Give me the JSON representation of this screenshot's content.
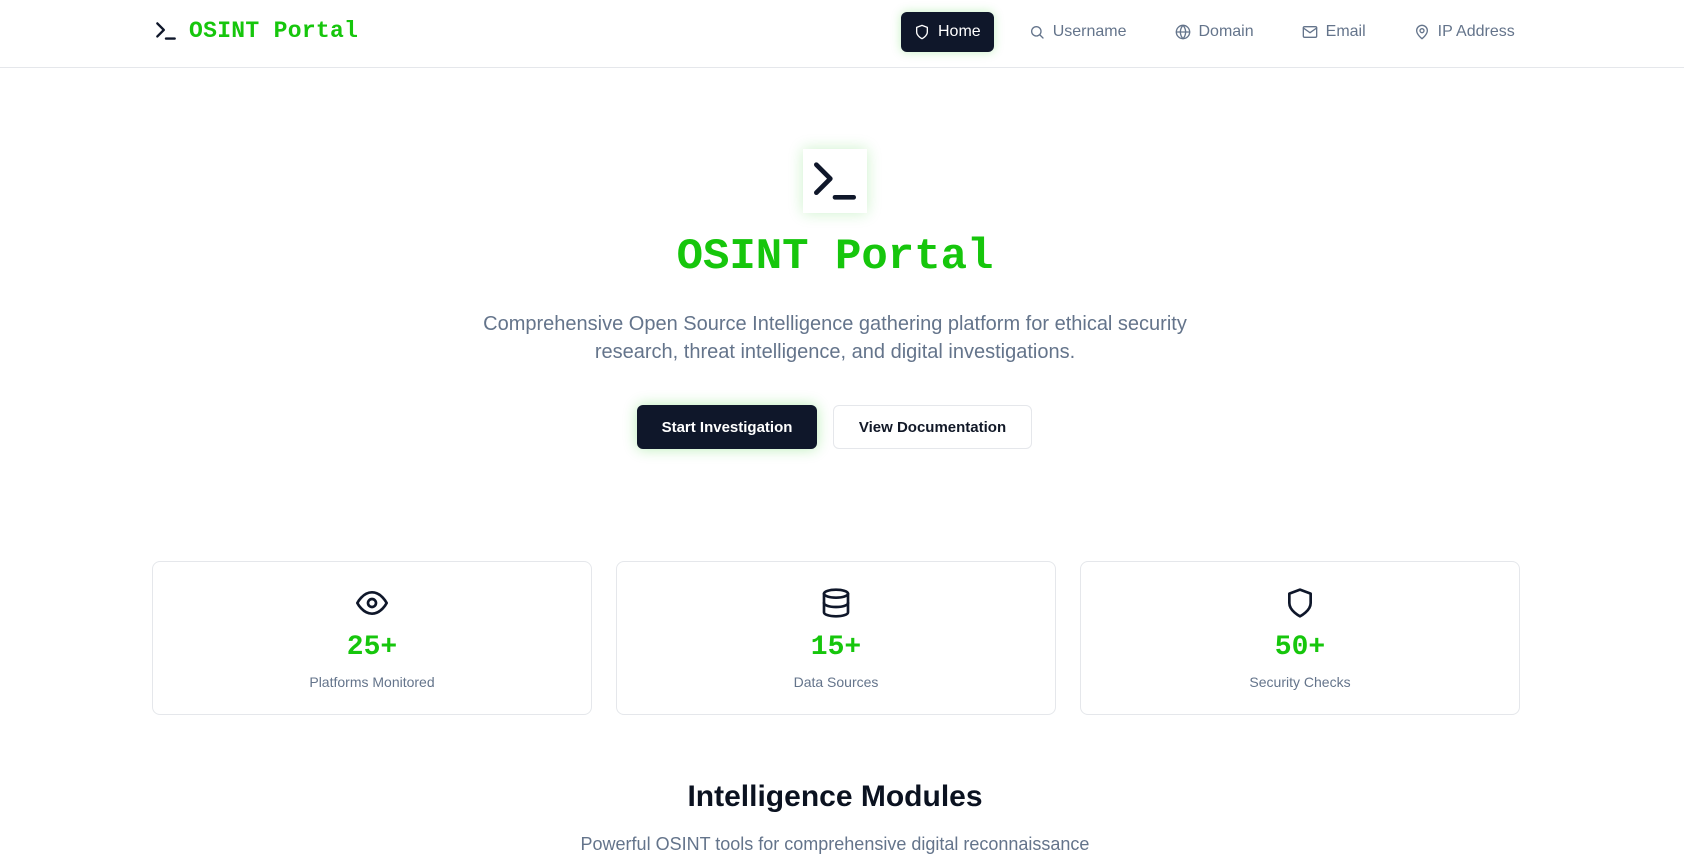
{
  "brand": {
    "name": "OSINT Portal",
    "icon": "terminal-icon"
  },
  "nav": {
    "items": [
      {
        "label": "Home",
        "icon": "shield-icon",
        "active": true
      },
      {
        "label": "Username",
        "icon": "search-icon"
      },
      {
        "label": "Domain",
        "icon": "globe-icon"
      },
      {
        "label": "Email",
        "icon": "mail-icon"
      },
      {
        "label": "IP Address",
        "icon": "map-pin-icon"
      }
    ]
  },
  "hero": {
    "icon": "terminal-icon",
    "title": "OSINT Portal",
    "subtitle_line1": "Comprehensive Open Source Intelligence gathering platform for ethical security",
    "subtitle_line2": "research, threat intelligence, and digital investigations.",
    "primary_button": "Start Investigation",
    "secondary_button": "View Documentation"
  },
  "stats": [
    {
      "icon": "eye-icon",
      "value": "25+",
      "label": "Platforms Monitored"
    },
    {
      "icon": "database-icon",
      "value": "15+",
      "label": "Data Sources"
    },
    {
      "icon": "shield-icon",
      "value": "50+",
      "label": "Security Checks"
    }
  ],
  "modules": {
    "title": "Intelligence Modules",
    "subtitle": "Powerful OSINT tools for comprehensive digital reconnaissance"
  },
  "colors": {
    "accent": "#16c60c",
    "dark": "#0f172a",
    "muted": "#64748b",
    "border": "#e5e7eb"
  }
}
